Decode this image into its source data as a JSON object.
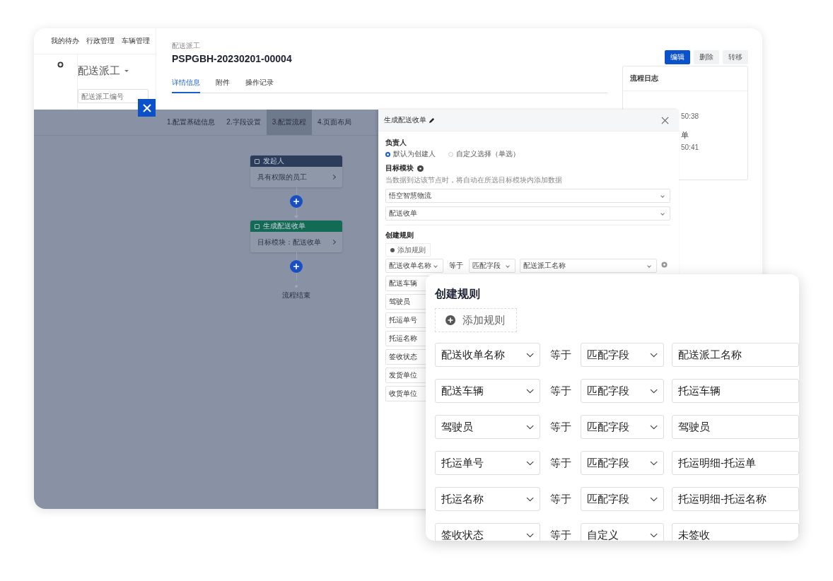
{
  "back_window": {
    "nav": [
      "我的待办",
      "行政管理",
      "车辆管理"
    ],
    "list_title": "配送派工",
    "search": {
      "placeholder": "配送派工编号"
    },
    "breadcrumb": "配送派工",
    "record_id": "PSPGBH-20230201-00004",
    "actions": [
      {
        "label": "编辑",
        "primary": true
      },
      {
        "label": "删除",
        "primary": false
      },
      {
        "label": "转移",
        "primary": false
      }
    ],
    "tabs": [
      {
        "label": "详情信息",
        "selected": true
      },
      {
        "label": "附件",
        "selected": false
      },
      {
        "label": "操作记录",
        "selected": false
      }
    ],
    "log": {
      "title": "流程日志",
      "entries": [
        {
          "time": "50:38"
        },
        {
          "title": "单",
          "time": "50:41"
        }
      ]
    }
  },
  "flow_editor": {
    "steps": [
      {
        "label": "1.配置基础信息",
        "selected": false
      },
      {
        "label": "2.字段设置",
        "selected": false
      },
      {
        "label": "3.配置流程",
        "selected": true
      },
      {
        "label": "4.页面布局",
        "selected": false
      }
    ],
    "nodes": [
      {
        "kind": "start",
        "title": "发起人",
        "body": "具有权限的员工"
      },
      {
        "kind": "action",
        "title": "生成配送收单",
        "body": "目标模块：配送收单"
      }
    ],
    "end": "流程结束"
  },
  "drawer": {
    "title": "生成配送收单",
    "owner_label": "负责人",
    "owner_options": [
      {
        "label": "默认为创建人",
        "selected": true
      },
      {
        "label": "自定义选择（单选）",
        "selected": false
      }
    ],
    "target_label": "目标模块",
    "target_hint": "当数据到达该节点时，将自动在所选目标模块内添加数据",
    "target_selects": [
      "悟空智慧物流",
      "配送收单"
    ],
    "rules_label": "创建规则",
    "add_rule": "添加规则",
    "rule": {
      "field": "配送收单名称",
      "op": "等于",
      "mode": "匹配字段",
      "value": "配送派工名称"
    },
    "more_fields": [
      "配送车辆",
      "驾驶员",
      "托运单号",
      "托运名称",
      "签收状态",
      "发货单位",
      "收货单位"
    ]
  },
  "rules_card": {
    "title": "创建规则",
    "add_rule": "添加规则",
    "rules": [
      {
        "field": "配送收单名称",
        "op": "等于",
        "mode": "匹配字段",
        "value": "配送派工名称"
      },
      {
        "field": "配送车辆",
        "op": "等于",
        "mode": "匹配字段",
        "value": "托运车辆"
      },
      {
        "field": "驾驶员",
        "op": "等于",
        "mode": "匹配字段",
        "value": "驾驶员"
      },
      {
        "field": "托运单号",
        "op": "等于",
        "mode": "匹配字段",
        "value": "托运明细-托运单"
      },
      {
        "field": "托运名称",
        "op": "等于",
        "mode": "匹配字段",
        "value": "托运明细-托运名称"
      },
      {
        "field": "签收状态",
        "op": "等于",
        "mode": "自定义",
        "value": "未签收"
      }
    ]
  }
}
